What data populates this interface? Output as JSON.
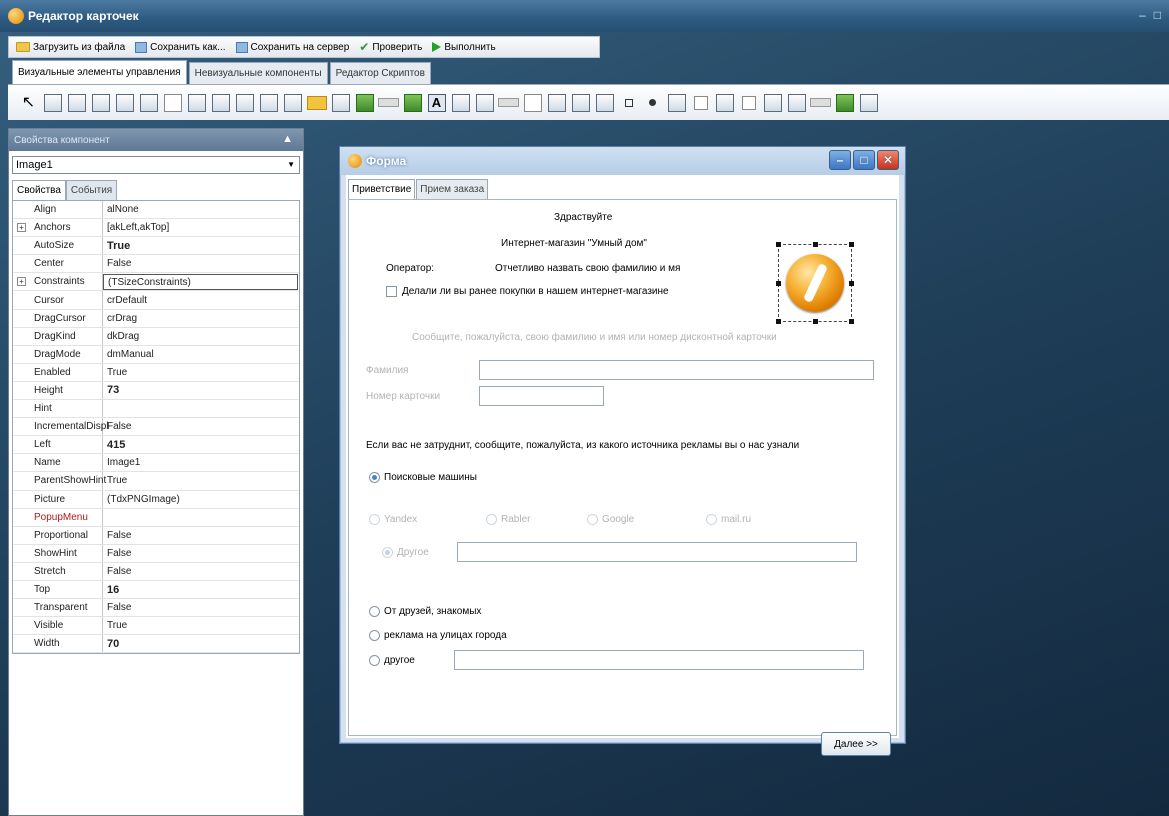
{
  "window": {
    "title": "Редактор карточек"
  },
  "commands": [
    {
      "label": "Загрузить из файла",
      "icon": "folder-icon"
    },
    {
      "label": "Сохранить как...",
      "icon": "save-icon"
    },
    {
      "label": "Сохранить на сервер",
      "icon": "save-icon"
    },
    {
      "label": "Проверить",
      "icon": "check-icon"
    },
    {
      "label": "Выполнить",
      "icon": "play-icon"
    }
  ],
  "tabs": [
    "Визуальные элементы управления",
    "Невизуальные компоненты",
    "Редактор Скриптов"
  ],
  "properties_panel": {
    "title": "Свойства компонент",
    "component": "Image1",
    "tabs": [
      "Свойства",
      "События"
    ],
    "rows": [
      {
        "name": "Align",
        "value": "alNone"
      },
      {
        "name": "Anchors",
        "value": "[akLeft,akTop]",
        "expandable": true
      },
      {
        "name": "AutoSize",
        "value": "True",
        "bold": true
      },
      {
        "name": "Center",
        "value": "False"
      },
      {
        "name": "Constraints",
        "value": "(TSizeConstraints)",
        "expandable": true,
        "boxed": true
      },
      {
        "name": "Cursor",
        "value": "crDefault"
      },
      {
        "name": "DragCursor",
        "value": "crDrag"
      },
      {
        "name": "DragKind",
        "value": "dkDrag"
      },
      {
        "name": "DragMode",
        "value": "dmManual"
      },
      {
        "name": "Enabled",
        "value": "True"
      },
      {
        "name": "Height",
        "value": "73",
        "bold": true
      },
      {
        "name": "Hint",
        "value": ""
      },
      {
        "name": "IncrementalDispl",
        "value": "False"
      },
      {
        "name": "Left",
        "value": "415",
        "bold": true
      },
      {
        "name": "Name",
        "value": "Image1"
      },
      {
        "name": "ParentShowHint",
        "value": "True"
      },
      {
        "name": "Picture",
        "value": "(TdxPNGImage)"
      },
      {
        "name": "PopupMenu",
        "value": "",
        "red": true
      },
      {
        "name": "Proportional",
        "value": "False"
      },
      {
        "name": "ShowHint",
        "value": "False"
      },
      {
        "name": "Stretch",
        "value": "False"
      },
      {
        "name": "Top",
        "value": "16",
        "bold": true
      },
      {
        "name": "Transparent",
        "value": "False"
      },
      {
        "name": "Visible",
        "value": "True"
      },
      {
        "name": "Width",
        "value": "70",
        "bold": true
      }
    ]
  },
  "form": {
    "title": "Форма",
    "tabs": [
      "Приветствие",
      "Прием заказа"
    ],
    "greeting": "Здраствуйте",
    "shop_name": "Интернет-магазин \"Умный дом\"",
    "operator_label": "Оператор:",
    "operator_text": "Отчетливо назвать свою фамилию и мя",
    "checkbox_label": "Делали ли вы ранее покупки в нашем интернет-магазине",
    "info_text": "Сообщите, пожалуйста, свою фамилию и имя или номер дисконтной карточки",
    "surname_label": "Фамилия",
    "card_label": "Номер карточки",
    "question": "Если вас не затруднит, сообщите, пожалуйста, из какого источника рекламы вы о нас узнали",
    "opt_search": "Поисковые машины",
    "engines": [
      "Yandex",
      "Rabler",
      "Google",
      "mail.ru"
    ],
    "opt_other_engine": "Другое",
    "opt_friends": "От друзей, знакомых",
    "opt_street": "реклама на улицах города",
    "opt_other": "другое",
    "next_button": "Далее >>"
  }
}
